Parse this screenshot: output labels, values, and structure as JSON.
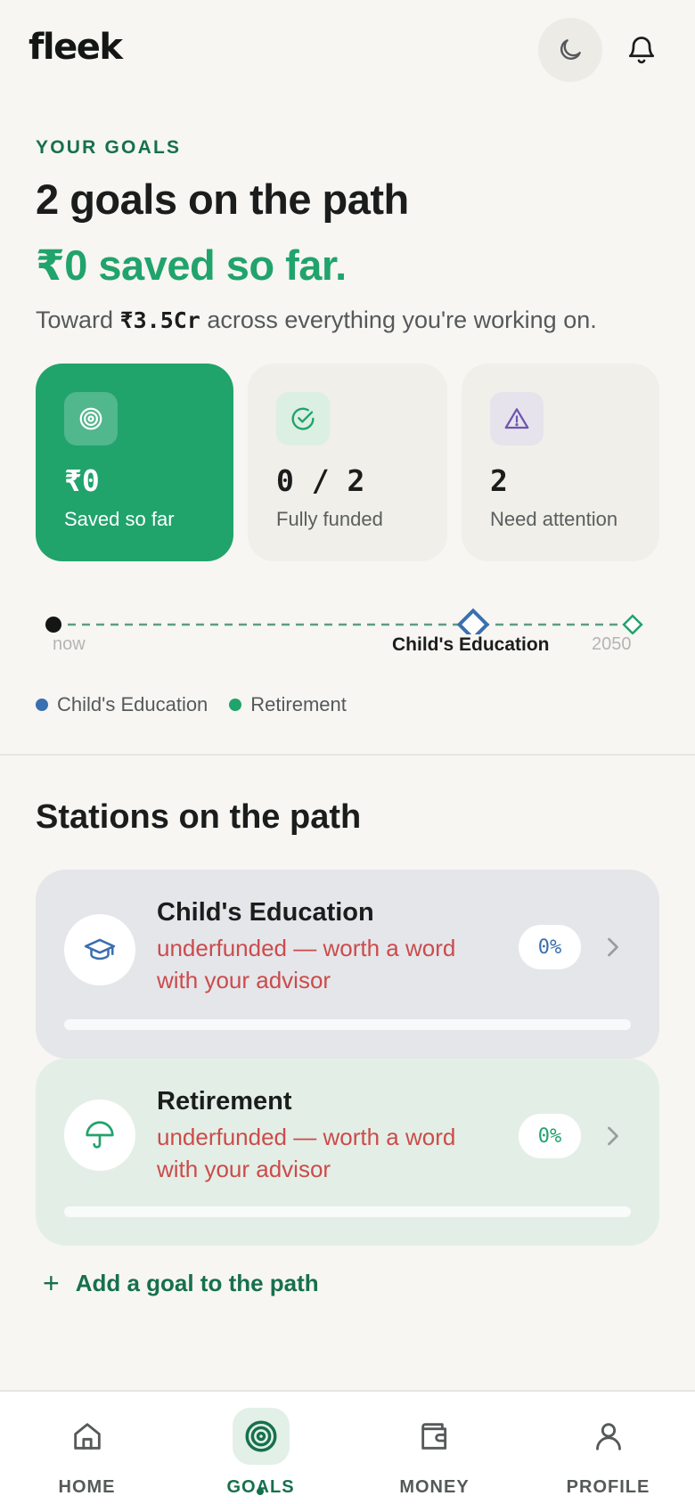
{
  "app": {
    "logo": "fleek"
  },
  "header": {
    "theme_icon": "moon-icon",
    "notifications_icon": "bell-icon"
  },
  "hero": {
    "eyebrow": "YOUR GOALS",
    "headline": "2 goals on the path",
    "saved_line": "₹0 saved so far.",
    "toward_prefix": "Toward ",
    "toward_amount": "₹3.5Cr",
    "toward_suffix": " across everything you're working on."
  },
  "stats": [
    {
      "icon": "target-icon",
      "value": "₹0",
      "label": "Saved so far"
    },
    {
      "icon": "check-circle-icon",
      "value": "0 / 2",
      "label": "Fully funded"
    },
    {
      "icon": "warning-icon",
      "value": "2",
      "label": "Need attention"
    }
  ],
  "timeline": {
    "start_label": "now",
    "goal_label": "Child's Education",
    "end_label": "2050"
  },
  "legend": [
    {
      "label": "Child's Education",
      "color": "#3a6fb0"
    },
    {
      "label": "Retirement",
      "color": "#21a36c"
    }
  ],
  "stations": {
    "title": "Stations on the path",
    "goals": [
      {
        "icon": "graduation-cap-icon",
        "name": "Child's Education",
        "status": "underfunded — worth a word with your advisor",
        "percent_label": "0%",
        "progress": 0,
        "accent": "#3a6fb0",
        "bg": "#e4e6ea"
      },
      {
        "icon": "umbrella-icon",
        "name": "Retirement",
        "status": "underfunded — worth a word with your advisor",
        "percent_label": "0%",
        "progress": 0,
        "accent": "#21a36c",
        "bg": "#e3efe6"
      }
    ],
    "add_label": "Add a goal to the path"
  },
  "nav": [
    {
      "icon": "home-icon",
      "label": "HOME"
    },
    {
      "icon": "target-icon",
      "label": "GOALS",
      "active": true
    },
    {
      "icon": "wallet-icon",
      "label": "MONEY"
    },
    {
      "icon": "user-icon",
      "label": "PROFILE"
    }
  ],
  "colors": {
    "brand": "#21a36c",
    "brand_dark": "#17704d",
    "warning": "#cc4b4b",
    "attention": "#6e56b0",
    "background": "#f7f6f2"
  }
}
